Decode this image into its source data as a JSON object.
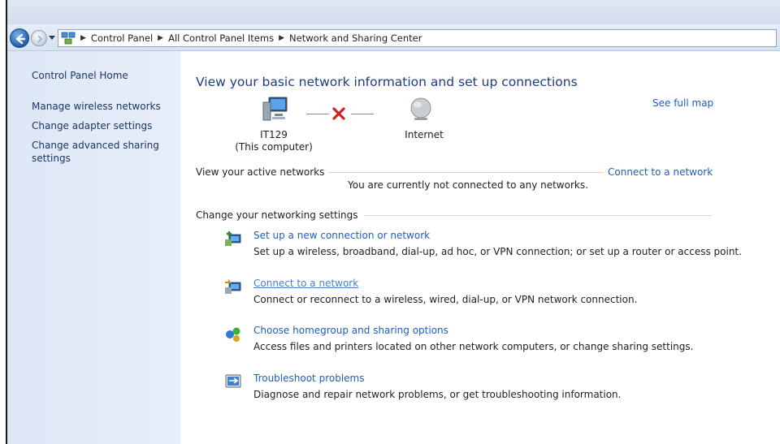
{
  "address_bar": {
    "crumbs": [
      "Control Panel",
      "All Control Panel Items",
      "Network and Sharing Center"
    ]
  },
  "sidebar": {
    "home": "Control Panel Home",
    "items": [
      {
        "label": "Manage wireless networks"
      },
      {
        "label": "Change adapter settings"
      },
      {
        "label": "Change advanced sharing settings"
      }
    ]
  },
  "main": {
    "heading": "View your basic network information and set up connections",
    "see_full_map": "See full map",
    "computer_name": "IT129",
    "computer_sub": "(This computer)",
    "internet_label": "Internet",
    "active_networks_label": "View your active networks",
    "connect_link": "Connect to a network",
    "not_connected": "You are currently not connected to any networks.",
    "change_settings_label": "Change your networking settings",
    "tasks": [
      {
        "icon": "new-connection-icon",
        "link": "Set up a new connection or network",
        "desc": "Set up a wireless, broadband, dial-up, ad hoc, or VPN connection; or set up a router or access point."
      },
      {
        "icon": "connect-network-icon",
        "link": "Connect to a network",
        "desc": "Connect or reconnect to a wireless, wired, dial-up, or VPN network connection."
      },
      {
        "icon": "homegroup-icon",
        "link": "Choose homegroup and sharing options",
        "desc": "Access files and printers located on other network computers, or change sharing settings."
      },
      {
        "icon": "troubleshoot-icon",
        "link": "Troubleshoot problems",
        "desc": "Diagnose and repair network problems, or get troubleshooting information."
      }
    ]
  },
  "colors": {
    "link": "#1e5fbf",
    "heading": "#1e3c82",
    "sidebar_bg": "#dde7f5",
    "disconnected": "#d42020"
  }
}
